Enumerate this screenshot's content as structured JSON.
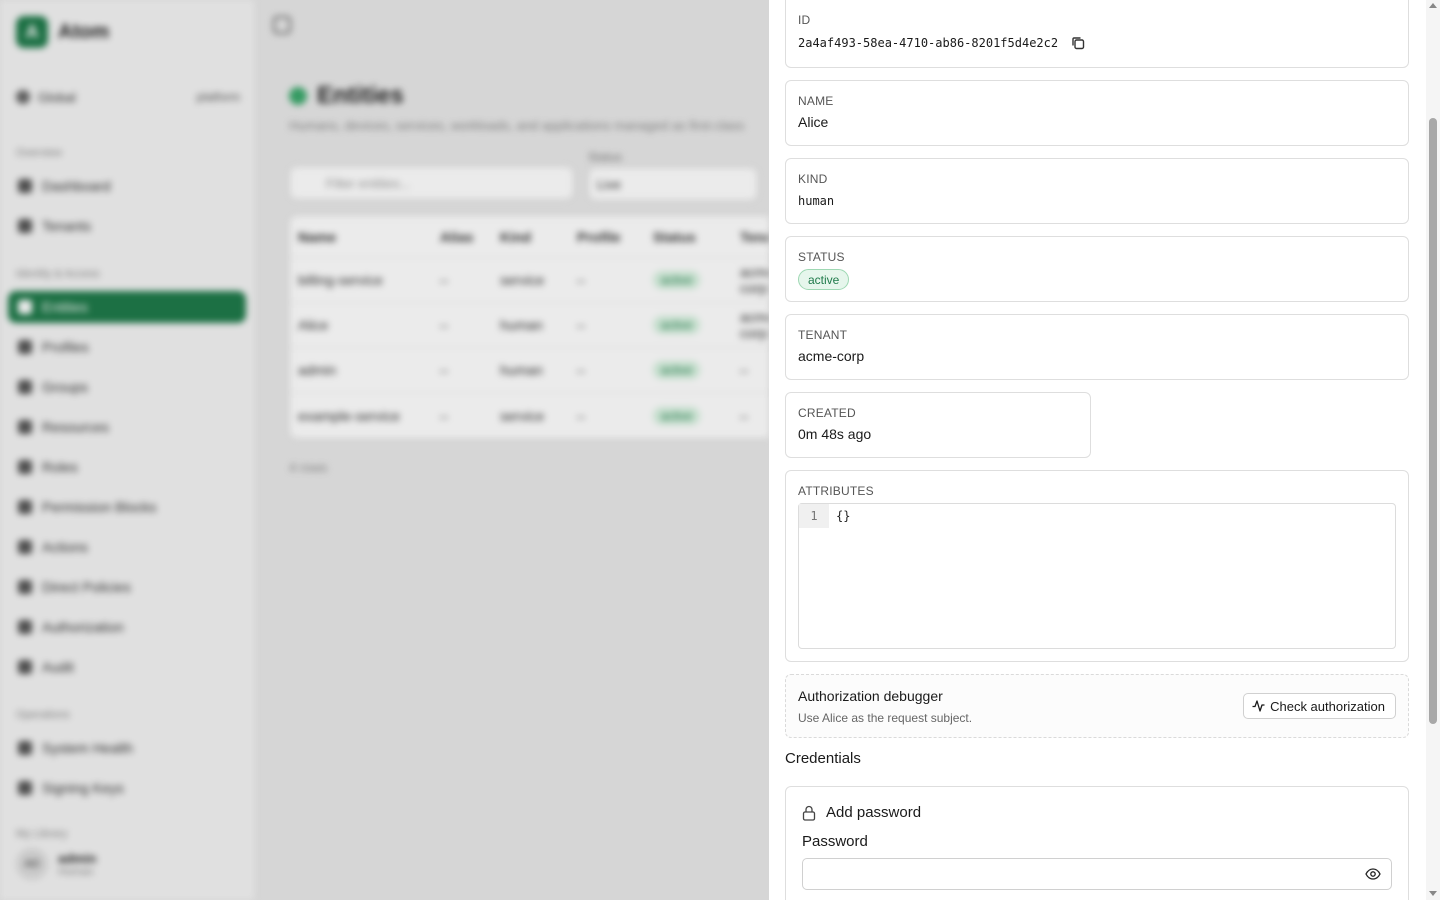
{
  "app": {
    "name": "Atom",
    "logo_letter": "A",
    "scope": {
      "label": "Global",
      "right": "platform"
    },
    "sections": {
      "overview": "Overview",
      "identity": "Identity & Access",
      "operations": "Operations",
      "me": "My Library"
    },
    "nav": {
      "dashboard": "Dashboard",
      "tenants": "Tenants",
      "entities": "Entities",
      "profiles": "Profiles",
      "groups": "Groups",
      "resources": "Resources",
      "roles": "Roles",
      "permission_blocks": "Permission Blocks",
      "actions": "Actions",
      "direct_policies": "Direct Policies",
      "authorization": "Authorization",
      "audit": "Audit",
      "system_health": "System Health",
      "signing_keys": "Signing Keys"
    },
    "user": {
      "initials": "AD",
      "name": "admin",
      "role": "Human"
    }
  },
  "main": {
    "title": "Entities",
    "description": "Humans, devices, services, workloads, and applications managed as first-class",
    "filter_placeholder": "Filter entities...",
    "status_label": "Status",
    "status_value": "Live",
    "columns": [
      "Name",
      "Alias",
      "Kind",
      "Profile",
      "Status",
      "Tenant"
    ],
    "rows": [
      {
        "name": "billing-service",
        "alias": "–",
        "kind": "service",
        "profile": "–",
        "status": "active",
        "tenant": "acme-corp"
      },
      {
        "name": "Alice",
        "alias": "–",
        "kind": "human",
        "profile": "–",
        "status": "active",
        "tenant": "acme-corp"
      },
      {
        "name": "admin",
        "alias": "–",
        "kind": "human",
        "profile": "–",
        "status": "active",
        "tenant": "–"
      },
      {
        "name": "example-service",
        "alias": "–",
        "kind": "service",
        "profile": "–",
        "status": "active",
        "tenant": "–"
      }
    ],
    "count": "4 rows"
  },
  "detail": {
    "id_label": "ID",
    "id_value": "2a4af493-58ea-4710-ab86-8201f5d4e2c2",
    "name_label": "NAME",
    "name_value": "Alice",
    "kind_label": "KIND",
    "kind_value": "human",
    "status_label": "STATUS",
    "status_value": "active",
    "tenant_label": "TENANT",
    "tenant_value": "acme-corp",
    "created_label": "CREATED",
    "created_value": "0m 48s ago",
    "attributes_label": "ATTRIBUTES",
    "attributes_line_no": "1",
    "attributes_value": "{}",
    "debugger_title": "Authorization debugger",
    "debugger_subtitle": "Use Alice as the request subject.",
    "check_button": "Check authorization",
    "credentials_title": "Credentials",
    "add_password": "Add password",
    "password_label": "Password",
    "password_value": ""
  },
  "colors": {
    "accent": "#1f7a4a",
    "status_bg": "#e6f6ec",
    "status_border": "#9ed8b3"
  },
  "icons": {
    "copy": "copy-icon",
    "lock": "lock-icon",
    "eye": "eye-icon",
    "activity": "activity-icon"
  }
}
